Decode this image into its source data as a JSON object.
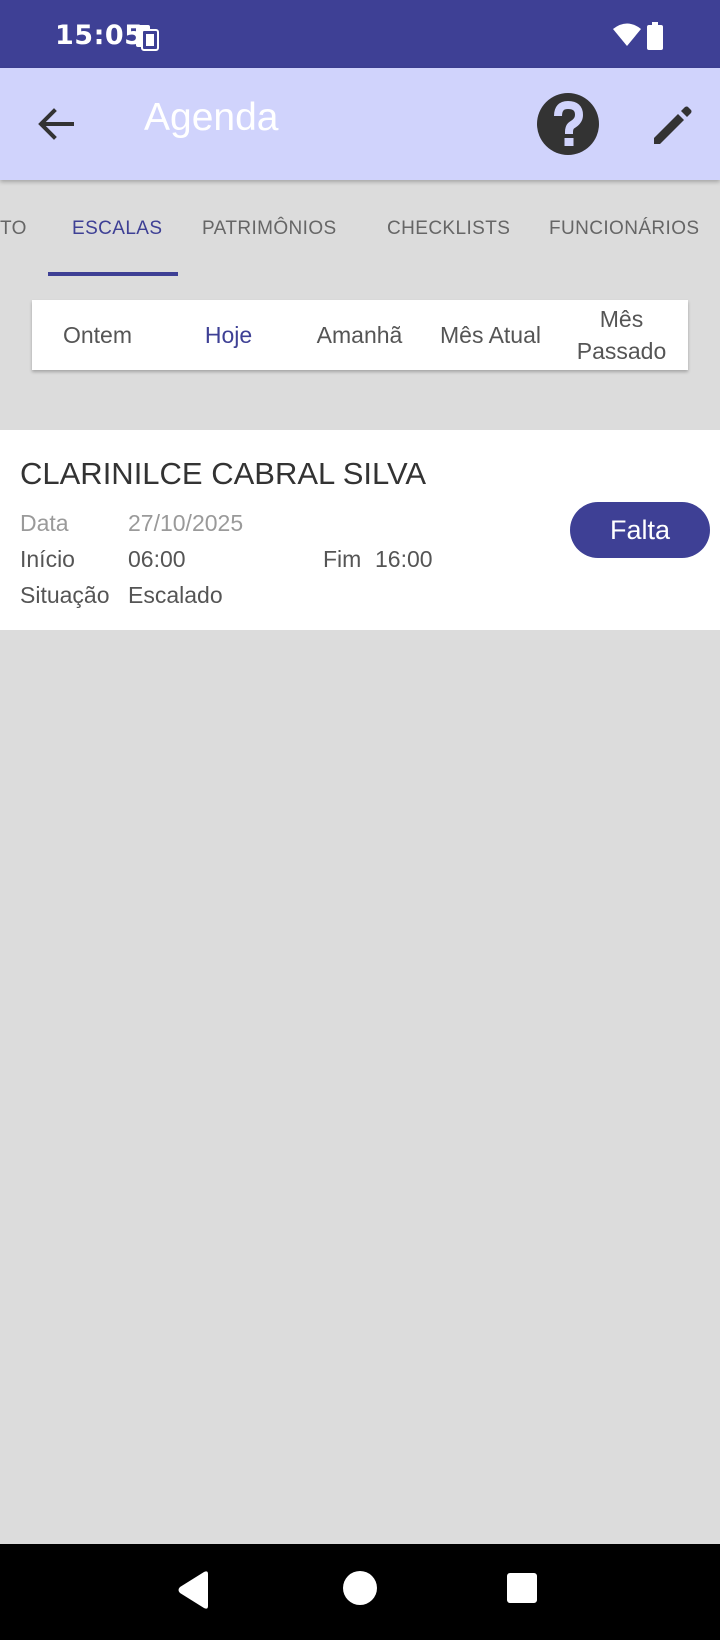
{
  "status_bar": {
    "time": "15:05",
    "icons": [
      "sim-card-icon",
      "wifi-icon",
      "battery-icon"
    ]
  },
  "app_bar": {
    "title": "Agenda",
    "icons": [
      "back-arrow-icon",
      "help-icon",
      "edit-pencil-icon"
    ]
  },
  "tabs": {
    "items": [
      {
        "label": "TO"
      },
      {
        "label": "ESCALAS"
      },
      {
        "label": "PATRIMÔNIOS"
      },
      {
        "label": "CHECKLISTS"
      },
      {
        "label": "FUNCIONÁRIOS"
      }
    ],
    "selected": "ESCALAS"
  },
  "periods": {
    "items": [
      {
        "label": "Ontem"
      },
      {
        "label": "Hoje"
      },
      {
        "label": "Amanhã"
      },
      {
        "label": "Mês Atual"
      },
      {
        "label": "Mês Passado"
      }
    ],
    "selected": "Hoje"
  },
  "schedule": {
    "employee_name": "CLARINILCE CABRAL SILVA",
    "date_label": "Data",
    "date_value": "27/10/2025",
    "start_label": "Início",
    "start_value": "06:00",
    "end_label": "Fim",
    "end_value": "16:00",
    "status_label": "Situação",
    "status_value": "Escalado",
    "action_label": "Falta"
  },
  "colors": {
    "primary": "#3e4095",
    "app_bar": "#d0d3fc",
    "background": "#dcdcdc"
  }
}
